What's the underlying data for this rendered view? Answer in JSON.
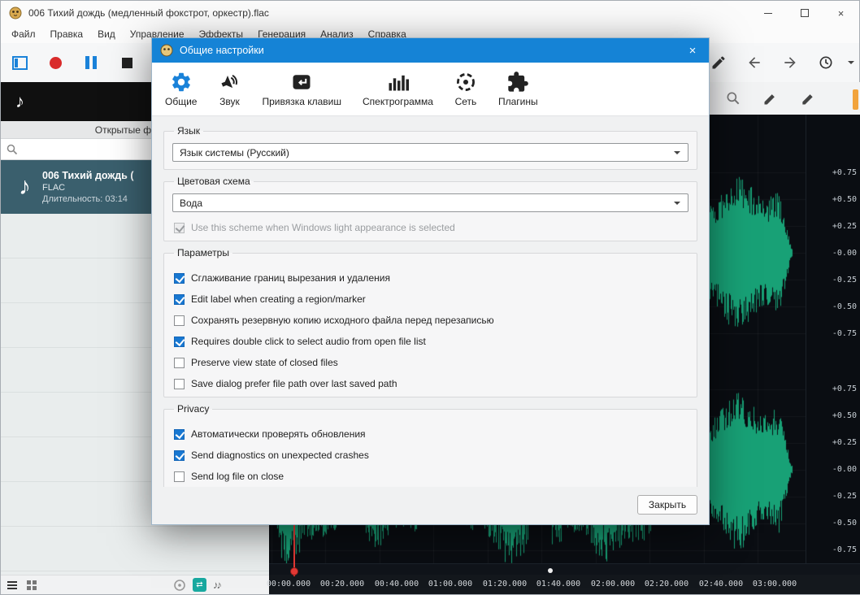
{
  "window": {
    "title": "006 Тихий дождь (медленный фокстрот, оркестр).flac",
    "menu": [
      "Файл",
      "Правка",
      "Вид",
      "Управление",
      "Эффекты",
      "Генерация",
      "Анализ",
      "Справка"
    ]
  },
  "sidebar": {
    "tab_title": "Открытые файлы",
    "file": {
      "title": "006 Тихий дождь (",
      "format": "FLAC",
      "duration": "Длительность: 03:14"
    }
  },
  "waveform": {
    "amplitude_labels": [
      "+0.75",
      "+0.50",
      "+0.25",
      "-0.00",
      "-0.25",
      "-0.50",
      "-0.75"
    ],
    "timeline": [
      "00:00.000",
      "00:20.000",
      "00:40.000",
      "01:00.000",
      "01:20.000",
      "01:40.000",
      "02:00.000",
      "02:20.000",
      "02:40.000",
      "03:00.000"
    ]
  },
  "dialog": {
    "title": "Общие настройки",
    "tabs": [
      {
        "label": "Общие",
        "active": true
      },
      {
        "label": "Звук",
        "active": false
      },
      {
        "label": "Привязка клавиш",
        "active": false
      },
      {
        "label": "Спектрограмма",
        "active": false
      },
      {
        "label": "Сеть",
        "active": false
      },
      {
        "label": "Плагины",
        "active": false
      }
    ],
    "language_group": {
      "label": "Язык",
      "value": "Язык системы (Русский)"
    },
    "scheme_group": {
      "label": "Цветовая схема",
      "value": "Вода",
      "checkbox": {
        "label": "Use this scheme when Windows light appearance is selected",
        "checked": true,
        "disabled": true
      }
    },
    "params_group": {
      "label": "Параметры",
      "items": [
        {
          "label": "Сглаживание границ вырезания и удаления",
          "checked": true
        },
        {
          "label": "Edit label when creating a region/marker",
          "checked": true
        },
        {
          "label": "Сохранять резервную копию исходного файла перед перезаписью",
          "checked": false
        },
        {
          "label": "Requires double click to select audio from open file list",
          "checked": true
        },
        {
          "label": "Preserve view state of closed files",
          "checked": false
        },
        {
          "label": "Save dialog prefer file path over last saved path",
          "checked": false
        }
      ]
    },
    "privacy_group": {
      "label": "Privacy",
      "items": [
        {
          "label": "Автоматически проверять обновления",
          "checked": true
        },
        {
          "label": "Send diagnostics on unexpected crashes",
          "checked": true
        },
        {
          "label": "Send log file on close",
          "checked": false
        }
      ]
    },
    "close_button": "Закрыть"
  },
  "colors": {
    "waveform": "#18a176",
    "playhead": "#e53935",
    "accent_blue": "#1777d1",
    "dialog_titlebar": "#1583d6",
    "record_red": "#d92b2b",
    "selected_file_bg": "#3a5f6d"
  }
}
